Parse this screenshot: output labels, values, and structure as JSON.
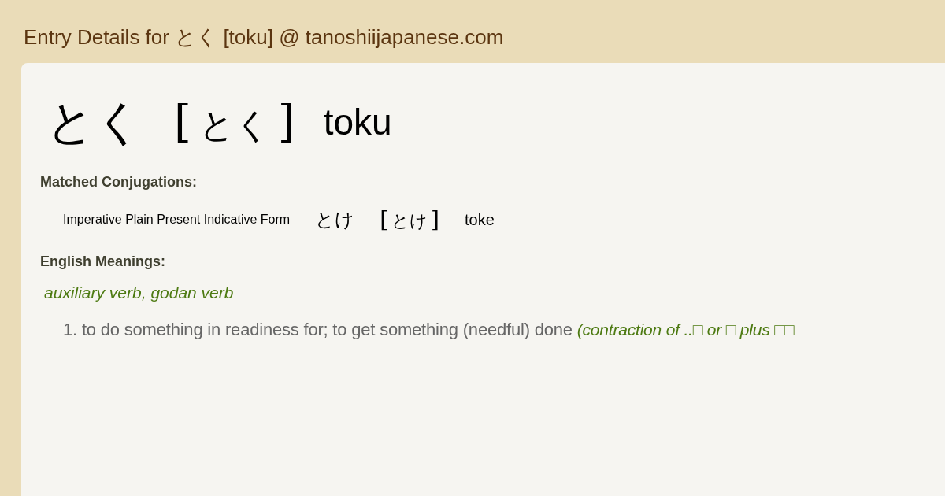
{
  "page_title": "Entry Details for とく [toku] @ tanoshiijapanese.com",
  "entry": {
    "word": "とく",
    "bracket_open": "[",
    "reading": "とく",
    "bracket_close": "]",
    "romaji": "toku"
  },
  "conjugations": {
    "heading": "Matched Conjugations:",
    "items": [
      {
        "form": "Imperative Plain Present Indicative Form",
        "word": "とけ",
        "bracket_open": "[",
        "reading": "とけ",
        "bracket_close": "]",
        "romaji": "toke"
      }
    ]
  },
  "meanings": {
    "heading": "English Meanings:",
    "part_of_speech": "auxiliary verb, godan verb",
    "senses": [
      {
        "number": "1.",
        "text": "to do something in readiness for; to get something (needful) done",
        "note": "(contraction of ..□ or □ plus □□"
      }
    ]
  }
}
